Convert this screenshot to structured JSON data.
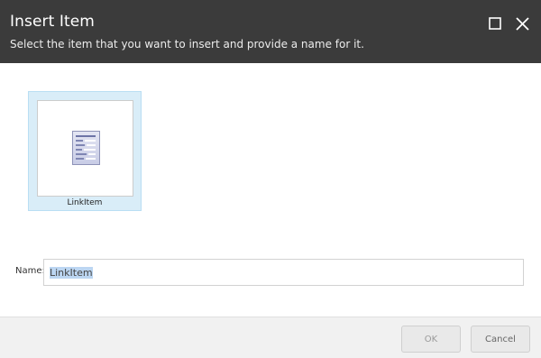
{
  "dialog": {
    "title": "Insert Item",
    "subtitle": "Select the item that you want to insert and provide a name for it."
  },
  "window_controls": {
    "maximize_icon": "maximize-icon",
    "close_icon": "close-icon"
  },
  "items": [
    {
      "label": "LinkItem",
      "icon": "document-list-icon",
      "selected": true
    }
  ],
  "name_field": {
    "label": "Name:",
    "value": "LinkItem"
  },
  "buttons": {
    "ok": "OK",
    "cancel": "Cancel"
  },
  "colors": {
    "header_bg": "#3b3b3b",
    "selection_bg": "#d9edf8",
    "footer_bg": "#f1f1f1"
  }
}
